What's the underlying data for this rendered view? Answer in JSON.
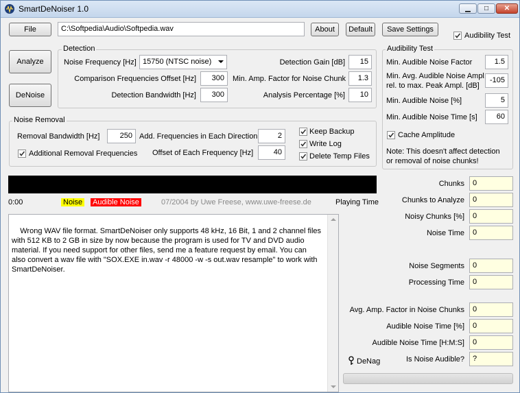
{
  "window": {
    "title": "SmartDeNoiser 1.0",
    "min": "▁",
    "max": "□",
    "close": "✕"
  },
  "toolbar": {
    "file_label": "File",
    "file_path": "C:\\Softpedia\\Audio\\Softpedia.wav",
    "about_label": "About",
    "default_label": "Default",
    "save_settings_label": "Save Settings",
    "audibility_test_label": "Audibility Test",
    "audibility_test_checked": true
  },
  "actions": {
    "analyze_label": "Analyze",
    "denoise_label": "DeNoise"
  },
  "detection": {
    "title": "Detection",
    "noise_frequency_label": "Noise Frequency [Hz]",
    "noise_frequency_value": "15750 (NTSC noise)",
    "comparison_offset_label": "Comparison Frequencies Offset [Hz]",
    "comparison_offset_value": "300",
    "bandwidth_label": "Detection Bandwidth [Hz]",
    "bandwidth_value": "300",
    "gain_label": "Detection Gain [dB]",
    "gain_value": "15",
    "min_amp_label": "Min. Amp. Factor for Noise Chunk",
    "min_amp_value": "1.3",
    "analysis_pct_label": "Analysis Percentage [%]",
    "analysis_pct_value": "10"
  },
  "audibility": {
    "title": "Audibility Test",
    "min_noise_factor_label": "Min. Audible Noise Factor",
    "min_noise_factor_value": "1.5",
    "min_avg_label_1": "Min. Avg. Audible Noise Ampl.",
    "min_avg_label_2": "rel. to max. Peak Ampl. [dB]",
    "min_avg_value": "-105",
    "min_noise_pct_label": "Min. Audible Noise [%]",
    "min_noise_pct_value": "5",
    "min_noise_time_label": "Min. Audible Noise Time [s]",
    "min_noise_time_value": "60",
    "cache_amplitude_label": "Cache Amplitude",
    "cache_amplitude_checked": true,
    "note_1": "Note: This doesn't affect detection",
    "note_2": "or removal of noise chunks!"
  },
  "removal": {
    "title": "Noise Removal",
    "bandwidth_label": "Removal Bandwidth [Hz]",
    "bandwidth_value": "250",
    "add_freq_label": "Add. Frequencies in Each Direction",
    "add_freq_value": "2",
    "additional_label": "Additional Removal Frequencies",
    "additional_checked": true,
    "offset_label": "Offset of Each Frequency [Hz]",
    "offset_value": "40",
    "keep_backup_label": "Keep Backup",
    "keep_backup_checked": true,
    "write_log_label": "Write Log",
    "write_log_checked": true,
    "delete_temp_label": "Delete Temp Files",
    "delete_temp_checked": true
  },
  "timeline": {
    "time": "0:00",
    "noise_legend": "Noise",
    "audible_legend": "Audible Noise",
    "credit": "07/2004 by Uwe Freese, www.uwe-freese.de",
    "playing_time_label": "Playing Time"
  },
  "log": {
    "text": "Wrong WAV file format. SmartDeNoiser only supports 48 kHz, 16 Bit, 1 and 2 channel files\nwith 512 KB to 2 GB in size by now because the program is used for TV and DVD audio\nmaterial. If you need support for other files, send me a feature request by email. You can\nalso convert a wav file with \"SOX.EXE in.wav -r 48000 -w -s out.wav resample\" to work with\nSmartDeNoiser."
  },
  "stats": [
    {
      "label": "Chunks",
      "value": "0"
    },
    {
      "label": "Chunks to Analyze",
      "value": "0"
    },
    {
      "label": "Noisy Chunks [%]",
      "value": "0"
    },
    {
      "label": "Noise Time",
      "value": "0"
    },
    {
      "label": "Noise Segments",
      "value": "0"
    },
    {
      "label": "Processing Time",
      "value": "0"
    },
    {
      "label": "Avg. Amp. Factor in Noise Chunks",
      "value": "0"
    },
    {
      "label": "Audible Noise Time [%]",
      "value": "0"
    },
    {
      "label": "Audible Noise Time [H:M:S]",
      "value": "0"
    },
    {
      "label": "Is Noise Audible?",
      "value": "?"
    }
  ],
  "footer": {
    "denag_label": "DeNag"
  },
  "colors": {
    "noise": "#ffff00",
    "audible_noise": "#ff0000",
    "timeline_bg": "#000000"
  },
  "icons": {
    "app": "waveform-icon",
    "denag": "key-icon"
  }
}
